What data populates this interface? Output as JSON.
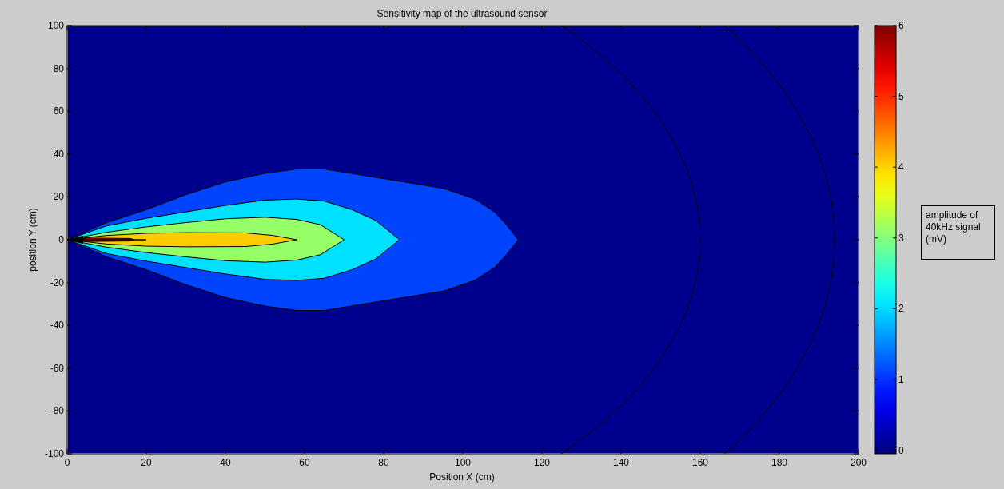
{
  "figure": {
    "title": "Sensitivity map of the ultrasound sensor",
    "x_axis": {
      "label": "Position X (cm)",
      "ticks": [
        "0",
        "20",
        "40",
        "60",
        "80",
        "100",
        "120",
        "140",
        "160",
        "180",
        "200"
      ]
    },
    "y_axis": {
      "label": "position Y (cm)",
      "ticks": [
        "100",
        "80",
        "60",
        "40",
        "20",
        "0",
        "-20",
        "-40",
        "-60",
        "-80",
        "-100"
      ]
    },
    "colorbar": {
      "ticks": [
        "6",
        "5",
        "4",
        "3",
        "2",
        "1",
        "0"
      ]
    },
    "annotation": "amplitude of\n40kHz signal\n(mV)"
  }
}
